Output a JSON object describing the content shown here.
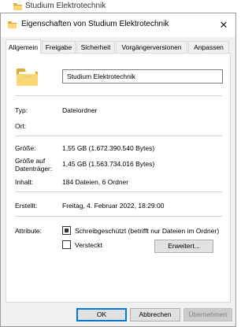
{
  "background_window": {
    "title": "Studium Elektrotechnik",
    "icon": "folder-icon"
  },
  "dialog": {
    "title": "Eigenschaften von Studium Elektrotechnik",
    "close_glyph": "✕"
  },
  "tabs": [
    {
      "label": "Allgemein",
      "active": true
    },
    {
      "label": "Freigabe",
      "active": false
    },
    {
      "label": "Sicherheit",
      "active": false
    },
    {
      "label": "Vorgängerversionen",
      "active": false
    },
    {
      "label": "Anpassen",
      "active": false
    }
  ],
  "general": {
    "folder_name": "Studium Elektrotechnik",
    "type_label": "Typ:",
    "type_value": "Dateiordner",
    "location_label": "Ort:",
    "location_value": "",
    "size_label": "Größe:",
    "size_value": "1,55 GB (1.672.390.540 Bytes)",
    "size_on_disk_label_1": "Größe auf",
    "size_on_disk_label_2": "Datenträger:",
    "size_on_disk_value": "1,45 GB (1.563.734.016 Bytes)",
    "contents_label": "Inhalt:",
    "contents_value": "184 Dateien, 6 Ordner",
    "created_label": "Erstellt:",
    "created_value": "Freitag, 4. Februar 2022, 18:29:00",
    "attributes_label": "Attribute:",
    "readonly_label": "Schreibgeschützt (betrifft nur Dateien im Ordner)",
    "readonly_state": "indeterminate",
    "hidden_label": "Versteckt",
    "hidden_state": "unchecked",
    "advanced_button": "Erweitert..."
  },
  "buttons": {
    "ok": "OK",
    "cancel": "Abbrechen",
    "apply": "Übernehmen"
  },
  "colors": {
    "folder_yellow": "#f8d775",
    "folder_dark": "#e0a82e",
    "accent_blue": "#0078d7"
  }
}
